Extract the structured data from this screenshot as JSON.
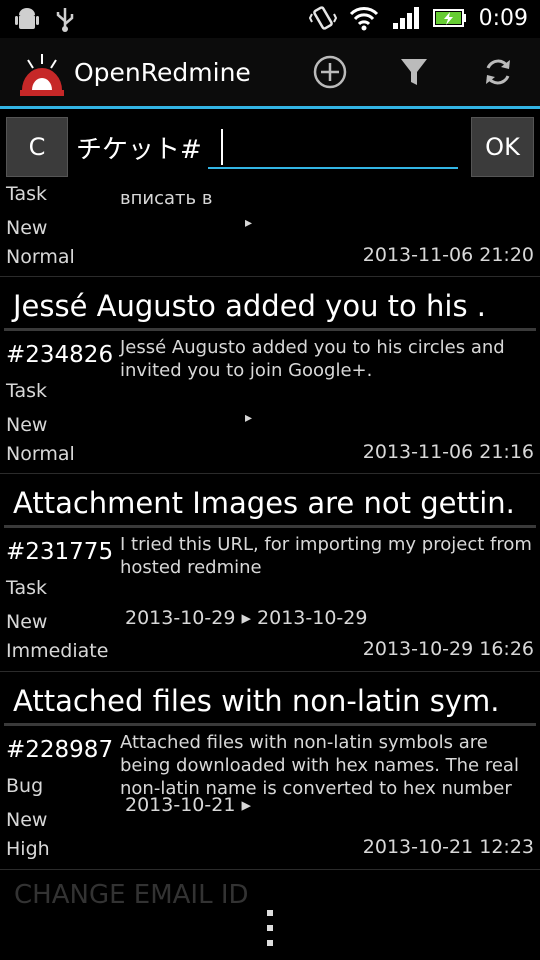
{
  "status": {
    "time": "0:09"
  },
  "app": {
    "title": "OpenRedmine"
  },
  "search": {
    "clear_label": "C",
    "label": "チケット#",
    "value": "",
    "ok_label": "OK"
  },
  "partial_item": {
    "tracker": "Task",
    "status": "New",
    "priority": "Normal",
    "desc_tail": "вписать в",
    "dates_arrow": "▸",
    "updated": "2013-11-06 21:20"
  },
  "issues": [
    {
      "title": "Jessé Augusto added you to his .",
      "id": "#234826",
      "desc": "Jessé Augusto added you to his circles and invited you to join Google+.",
      "tracker": "Task",
      "status": "New",
      "priority": "Normal",
      "dates": "▸",
      "updated": "2013-11-06 21:16"
    },
    {
      "title": "Attachment Images are not gettin.",
      "id": "#231775",
      "desc": "I tried this URL, for importing my project from hosted redmine",
      "tracker": "Task",
      "status": "New",
      "priority": "Immediate",
      "dates": "2013-10-29 ▸ 2013-10-29",
      "updated": "2013-10-29 16:26"
    },
    {
      "title": "Attached files with non-latin sym.",
      "id": "#228987",
      "desc": "Attached files with non-latin symbols are being downloaded with hex names. The real non-latin name is converted to hex number",
      "tracker": "Bug",
      "status": "New",
      "priority": "High",
      "dates": "2013-10-21 ▸",
      "updated": "2013-10-21 12:23"
    }
  ],
  "next_title_partial": "CHANGE EMAIL ID"
}
